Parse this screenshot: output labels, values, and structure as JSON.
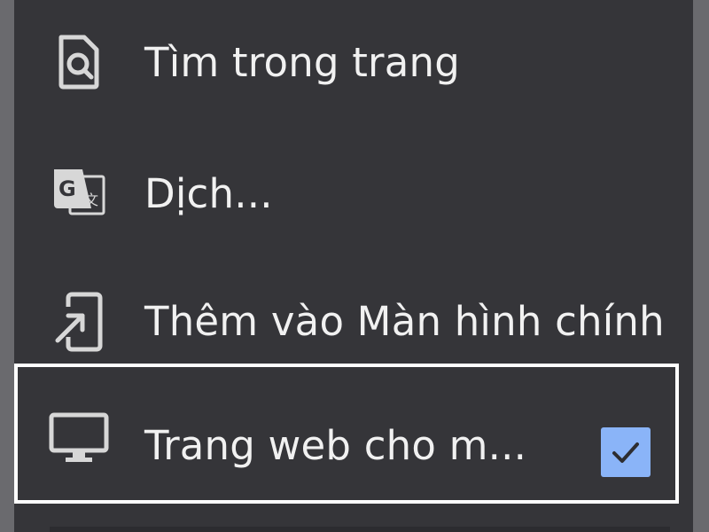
{
  "menu": {
    "items": [
      {
        "label": "Tìm trong trang",
        "icon": "find-in-page-icon"
      },
      {
        "label": "Dịch...",
        "icon": "translate-icon"
      },
      {
        "label": "Thêm vào Màn hình chính",
        "icon": "add-to-home-screen-icon"
      },
      {
        "label": "Trang web cho m...",
        "icon": "desktop-icon",
        "checked": true
      }
    ]
  },
  "colors": {
    "menu_background": "#353539",
    "text": "#f1f1f1",
    "icon": "#d7d7d7",
    "checkbox": "#8ab4f8",
    "highlight_border": "#ffffff"
  }
}
